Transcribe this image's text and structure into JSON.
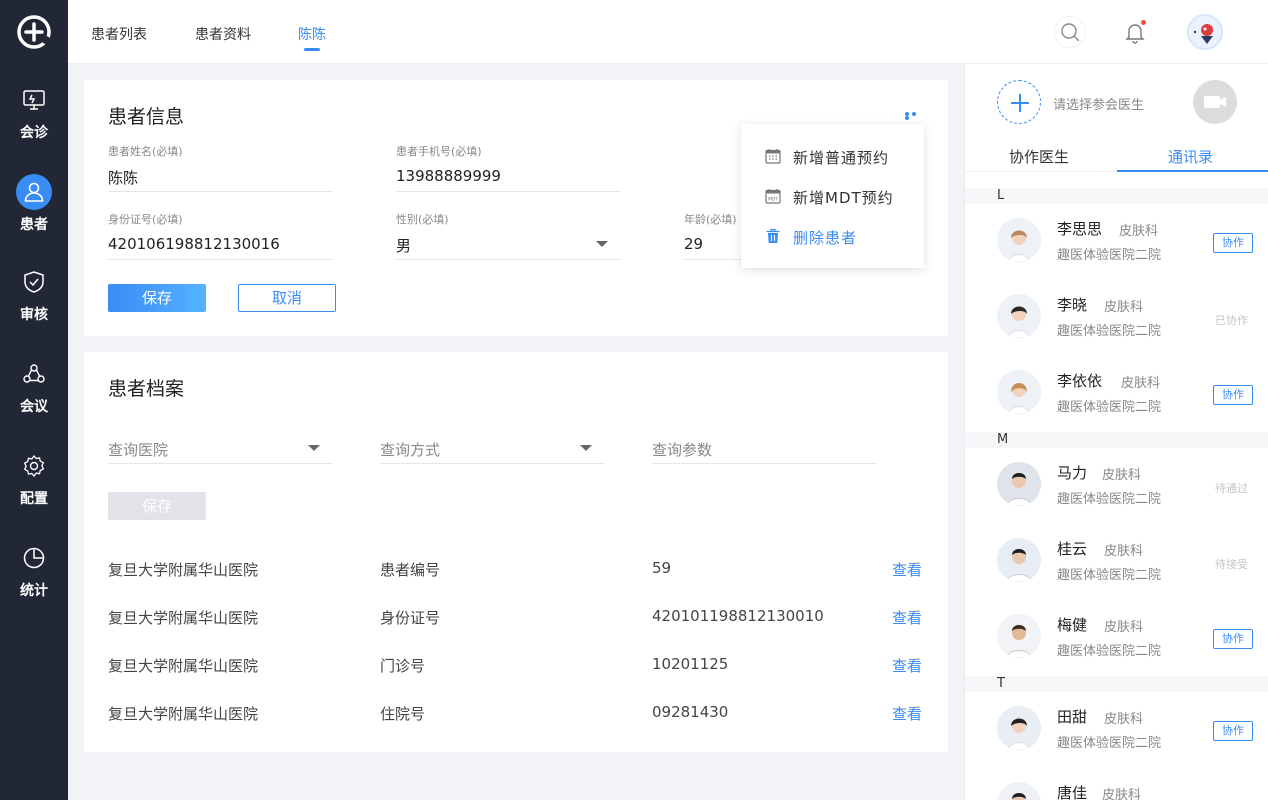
{
  "nav": {
    "items": [
      {
        "label": "会诊",
        "icon": "consult-icon"
      },
      {
        "label": "患者",
        "icon": "patient-icon"
      },
      {
        "label": "审核",
        "icon": "shield-check-icon"
      },
      {
        "label": "会议",
        "icon": "meeting-icon"
      },
      {
        "label": "配置",
        "icon": "gear-icon"
      },
      {
        "label": "统计",
        "icon": "pie-chart-icon"
      }
    ],
    "active_index": 1
  },
  "header": {
    "tabs": [
      {
        "label": "患者列表"
      },
      {
        "label": "患者资料"
      },
      {
        "label": "陈陈"
      }
    ],
    "active_tab": 2
  },
  "patient_info": {
    "title": "患者信息",
    "name_label": "患者姓名(必填)",
    "name_value": "陈陈",
    "phone_label": "患者手机号(必填)",
    "phone_value": "13988889999",
    "id_label": "身份证号(必填)",
    "id_value": "420106198812130016",
    "gender_label": "性别(必填)",
    "gender_value": "男",
    "age_label": "年龄(必填)",
    "age_value": "29",
    "save_label": "保存",
    "cancel_label": "取消"
  },
  "more_menu": {
    "items": [
      {
        "label": "新增普通预约",
        "icon": "calendar-icon"
      },
      {
        "label": "新增MDT预约",
        "icon": "calendar-mdt-icon"
      },
      {
        "label": "删除患者",
        "icon": "trash-icon"
      }
    ]
  },
  "archive": {
    "title": "患者档案",
    "hospital_placeholder": "查询医院",
    "method_placeholder": "查询方式",
    "param_placeholder": "查询参数",
    "save_label": "保存",
    "rows": [
      {
        "hospital": "复旦大学附属华山医院",
        "type": "患者编号",
        "value": "59",
        "action": "查看"
      },
      {
        "hospital": "复旦大学附属华山医院",
        "type": "身份证号",
        "value": "420101198812130010",
        "action": "查看"
      },
      {
        "hospital": "复旦大学附属华山医院",
        "type": "门诊号",
        "value": "10201125",
        "action": "查看"
      },
      {
        "hospital": "复旦大学附属华山医院",
        "type": "住院号",
        "value": "09281430",
        "action": "查看"
      }
    ]
  },
  "right_panel": {
    "select_hint": "请选择参会医生",
    "tabs": [
      {
        "label": "协作医生"
      },
      {
        "label": "通讯录"
      }
    ],
    "active_tab": 1,
    "groups": [
      {
        "letter": "L",
        "doctors": [
          {
            "name": "李思思",
            "dept": "皮肤科",
            "hospital": "趣医体验医院二院",
            "action": "协作",
            "status": ""
          },
          {
            "name": "李晓",
            "dept": "皮肤科",
            "hospital": "趣医体验医院二院",
            "action": "",
            "status": "已协作"
          },
          {
            "name": "李依依",
            "dept": "皮肤科",
            "hospital": "趣医体验医院二院",
            "action": "协作",
            "status": ""
          }
        ]
      },
      {
        "letter": "M",
        "doctors": [
          {
            "name": "马力",
            "dept": "皮肤科",
            "hospital": "趣医体验医院二院",
            "action": "",
            "status": "待通过"
          },
          {
            "name": "桂云",
            "dept": "皮肤科",
            "hospital": "趣医体验医院二院",
            "action": "",
            "status": "待接受"
          },
          {
            "name": "梅健",
            "dept": "皮肤科",
            "hospital": "趣医体验医院二院",
            "action": "协作",
            "status": ""
          }
        ]
      },
      {
        "letter": "T",
        "doctors": [
          {
            "name": "田甜",
            "dept": "皮肤科",
            "hospital": "趣医体验医院二院",
            "action": "协作",
            "status": ""
          },
          {
            "name": "唐佳",
            "dept": "皮肤科",
            "hospital": "",
            "action": "",
            "status": ""
          }
        ]
      }
    ]
  },
  "colors": {
    "accent": "#3a8cf5",
    "sidebar": "#222736",
    "danger_dot": "#f24e3d"
  }
}
